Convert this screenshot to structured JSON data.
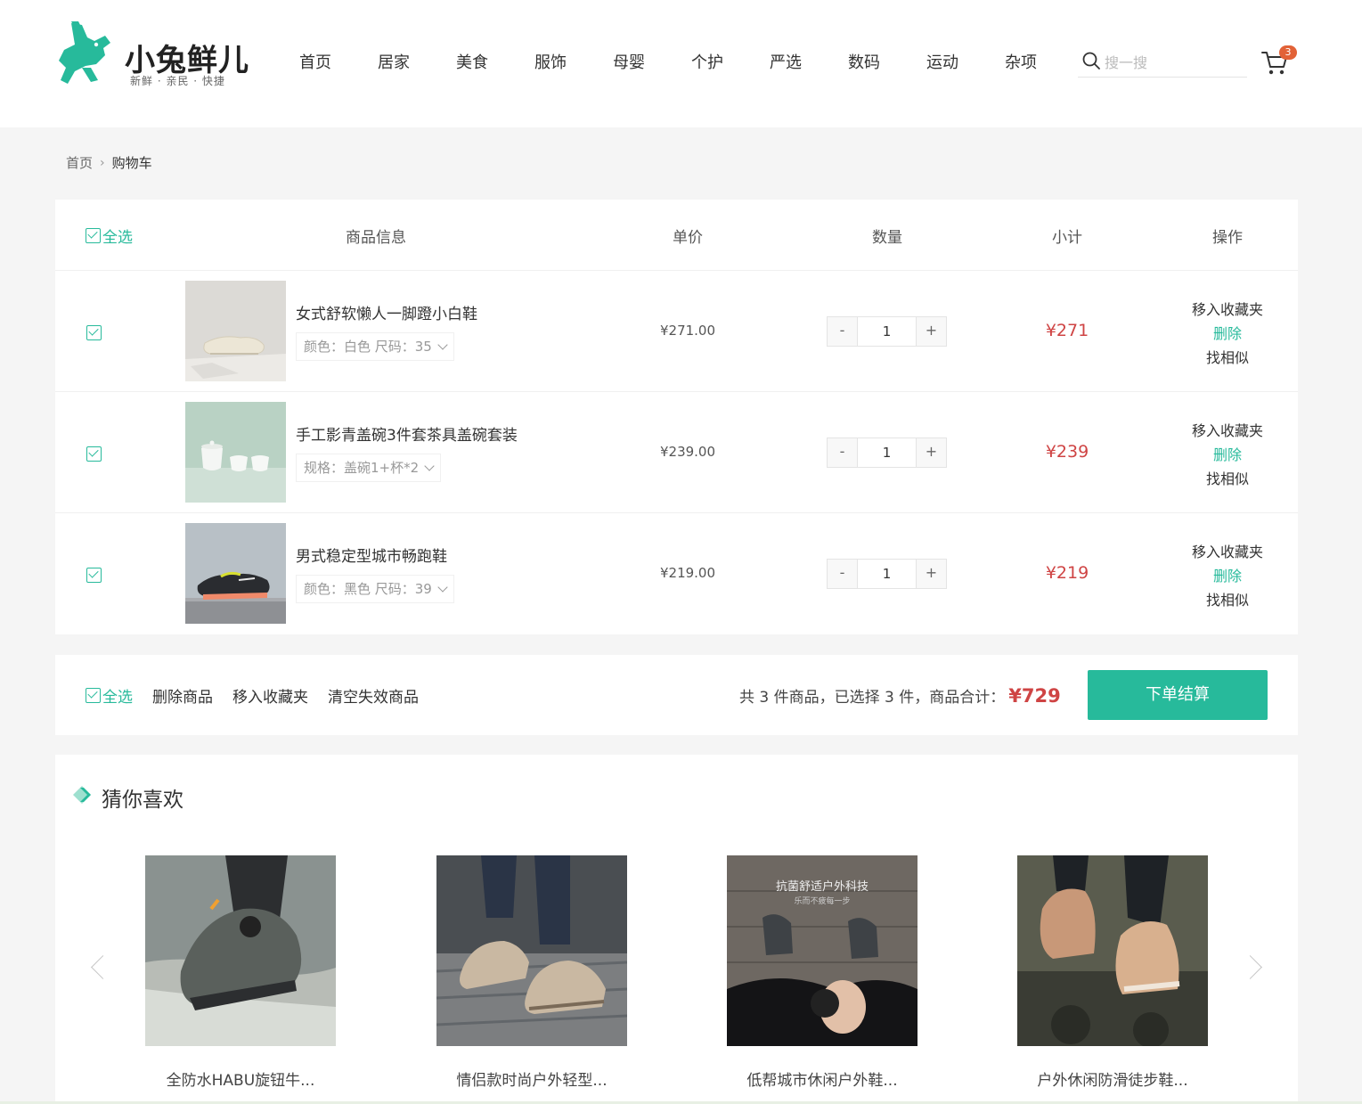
{
  "header": {
    "logo_text": "小兔鲜儿",
    "logo_slogan": "新鲜 · 亲民 · 快捷",
    "nav": [
      "首页",
      "居家",
      "美食",
      "服饰",
      "母婴",
      "个护",
      "严选",
      "数码",
      "运动",
      "杂项"
    ],
    "search": {
      "placeholder": "搜一搜",
      "value": ""
    },
    "cart_count": "3"
  },
  "breadcrumb": {
    "home": "首页",
    "current": "购物车"
  },
  "cart": {
    "columns": {
      "select_all": "全选",
      "info": "商品信息",
      "price": "单价",
      "qty": "数量",
      "subtotal": "小计",
      "ops": "操作"
    },
    "items": [
      {
        "name": "女式舒软懒人一脚蹬小白鞋",
        "spec": "颜色：白色 尺码：35",
        "price": "¥271.00",
        "qty": "1",
        "subtotal": "¥271",
        "checked": true
      },
      {
        "name": "手工影青盖碗3件套茶具盖碗套装",
        "spec": "规格：盖碗1+杯*2",
        "price": "¥239.00",
        "qty": "1",
        "subtotal": "¥239",
        "checked": true
      },
      {
        "name": "男式稳定型城市畅跑鞋",
        "spec": "颜色：黑色 尺码：39",
        "price": "¥219.00",
        "qty": "1",
        "subtotal": "¥219",
        "checked": true
      }
    ],
    "ops": {
      "favorite": "移入收藏夹",
      "delete": "删除",
      "similar": "找相似"
    },
    "qty_minus": "-",
    "qty_plus": "+"
  },
  "action_bar": {
    "select_all": "全选",
    "delete": "删除商品",
    "favorite": "移入收藏夹",
    "clear_invalid": "清空失效商品",
    "summary": "共 3 件商品，已选择 3 件，商品合计：",
    "total": "¥729",
    "checkout": "下单结算"
  },
  "recommend": {
    "title": "猜你喜欢",
    "items": [
      {
        "name": "全防水HABU旋钮牛..."
      },
      {
        "name": "情侣款时尚户外轻型..."
      },
      {
        "name": "低帮城市休闲户外鞋...",
        "overlay": "抗菌舒适户外科技",
        "overlay_sub": "乐而不疲每一步"
      },
      {
        "name": "户外休闲防滑徒步鞋..."
      }
    ]
  },
  "colors": {
    "brand": "#27ba9b",
    "price_red": "#cf4444",
    "badge": "#e26237"
  }
}
